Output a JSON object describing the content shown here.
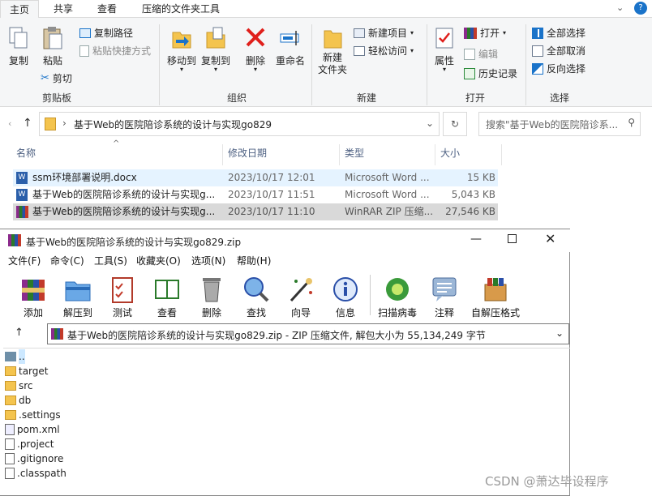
{
  "tabs": [
    "主页",
    "共享",
    "查看",
    "压缩的文件夹工具"
  ],
  "ribbon": {
    "copy": "复制",
    "paste": "粘贴",
    "copy_path": "复制路径",
    "paste_shortcut": "粘贴快捷方式",
    "cut": "剪切",
    "clipboard_group": "剪贴板",
    "move_to": "移动到",
    "copy_to": "复制到",
    "delete": "删除",
    "rename": "重命名",
    "organize_group": "组织",
    "new_folder": "新建\n文件夹",
    "new_item": "新建项目",
    "easy_access": "轻松访问",
    "new_group": "新建",
    "properties": "属性",
    "open": "打开",
    "edit": "编辑",
    "history": "历史记录",
    "open_group": "打开",
    "select_all": "全部选择",
    "select_none": "全部取消",
    "invert_selection": "反向选择",
    "select_group": "选择"
  },
  "address": {
    "path": "基于Web的医院陪诊系统的设计与实现go829",
    "search_placeholder": "搜索\"基于Web的医院陪诊系..."
  },
  "columns": {
    "name": "名称",
    "date": "修改日期",
    "type": "类型",
    "size": "大小"
  },
  "files": [
    {
      "name": "ssm环境部署说明.docx",
      "date": "2023/10/17 12:01",
      "type": "Microsoft Word ...",
      "size": "15 KB"
    },
    {
      "name": "基于Web的医院陪诊系统的设计与实现g...",
      "date": "2023/10/17 11:51",
      "type": "Microsoft Word ...",
      "size": "5,043 KB"
    },
    {
      "name": "基于Web的医院陪诊系统的设计与实现g...",
      "date": "2023/10/17 11:10",
      "type": "WinRAR ZIP 压缩...",
      "size": "27,546 KB"
    }
  ],
  "winrar": {
    "title": "基于Web的医院陪诊系统的设计与实现go829.zip",
    "menu": [
      "文件(F)",
      "命令(C)",
      "工具(S)",
      "收藏夹(O)",
      "选项(N)",
      "帮助(H)"
    ],
    "toolbar": [
      "添加",
      "解压到",
      "测试",
      "查看",
      "删除",
      "查找",
      "向导",
      "信息",
      "扫描病毒",
      "注释",
      "自解压格式"
    ],
    "path_bar": "基于Web的医院陪诊系统的设计与实现go829.zip - ZIP 压缩文件, 解包大小为 55,134,249 字节",
    "entries": [
      "..",
      "target",
      "src",
      "db",
      ".settings",
      "pom.xml",
      ".project",
      ".gitignore",
      ".classpath"
    ]
  },
  "watermark": "CSDN @萧达毕设程序",
  "colors": {
    "accent": "#1a73c9",
    "selected_row": "#cce8ff",
    "hover_row": "#e5f3ff"
  }
}
